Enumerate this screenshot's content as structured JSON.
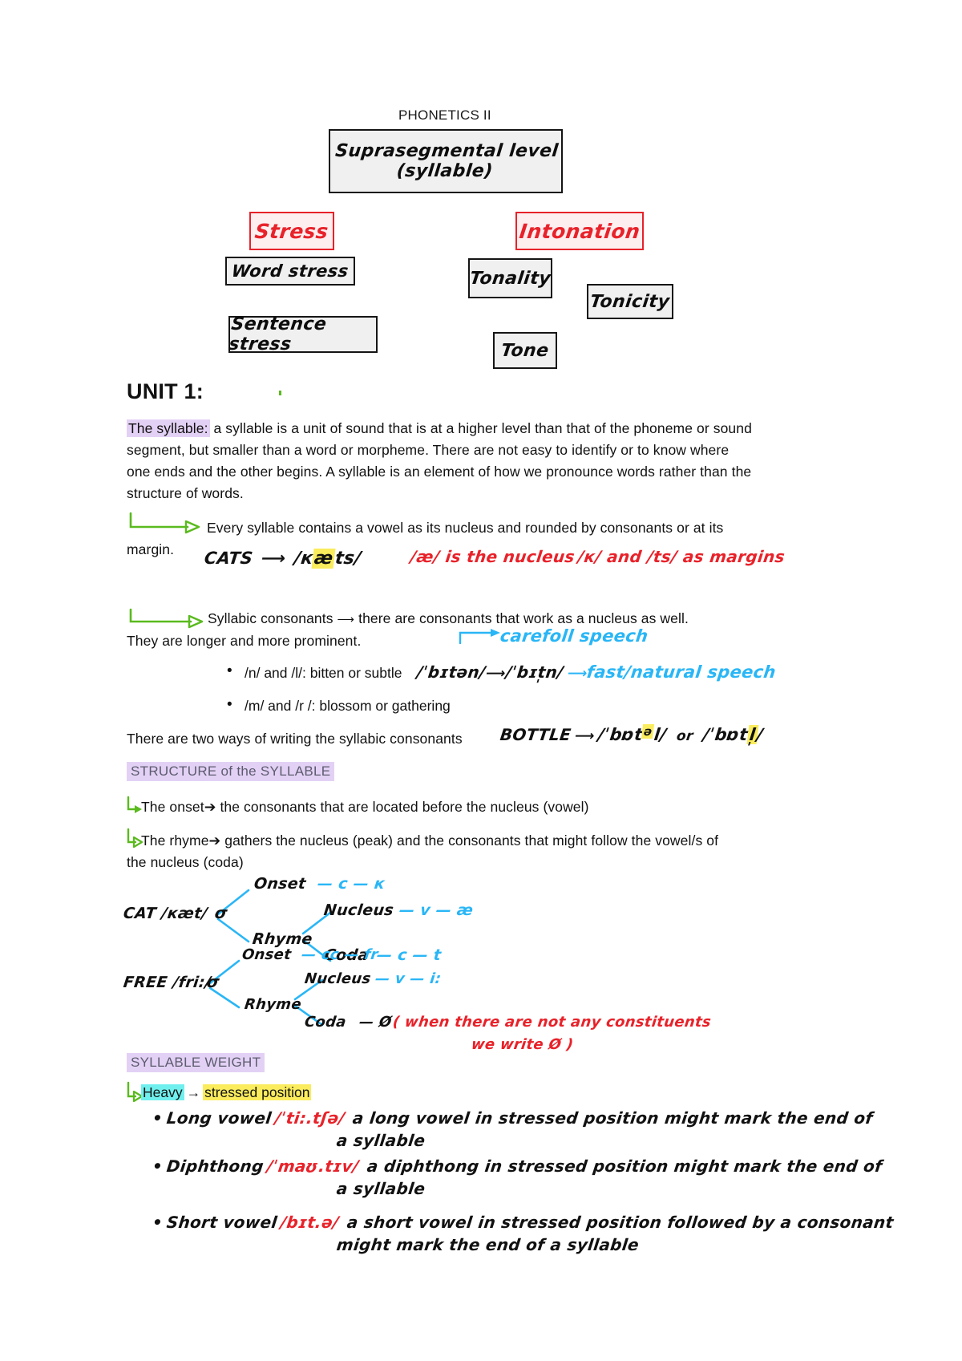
{
  "document": {
    "title": "PHONETICS II",
    "unit_heading": "UNIT 1:"
  },
  "diagram": {
    "nodes": [
      {
        "id": "supra",
        "label_line1": "Suprasegmental  level",
        "label_line2": "(syllable)",
        "style": "black"
      },
      {
        "id": "stress",
        "label": "Stress",
        "style": "red"
      },
      {
        "id": "word",
        "label": "Word stress",
        "style": "black"
      },
      {
        "id": "sentence",
        "label": "Sentence stress",
        "style": "black"
      },
      {
        "id": "intonation",
        "label": "Intonation",
        "style": "red"
      },
      {
        "id": "tonality",
        "label": "Tonality",
        "style": "black"
      },
      {
        "id": "tonicity",
        "label": "Tonicity",
        "style": "black"
      },
      {
        "id": "tone",
        "label": "Tone",
        "style": "black"
      }
    ]
  },
  "sections": {
    "syllable_def": {
      "label": "The syllable:",
      "text": " a syllable is a unit of sound that is at a higher level than that of the phoneme or sound segment, but smaller than a word or morpheme. There are not easy to identify or to know where one ends and the other begins. A syllable is an element of how we pronounce words rather than the structure of words."
    },
    "point_nucleus": {
      "text_before_margin": "Every syllable contains a vowel as its nucleus and rounded by consonants or at its",
      "text_margin": "margin.",
      "example_word": "CATS",
      "example_arrow": "⟶",
      "example_ipa_open": "/к",
      "example_ipa_highlight": "æ",
      "example_ipa_close": "ts/",
      "note_line1": "/æ/ is the nucleus",
      "note_line2": "/к/ and /ts/ as margins"
    },
    "point_syllabic": {
      "lead": "Syllabic consonants",
      "arrow": "⟶",
      "rest": "there are consonants that work as a nucleus as well.",
      "line2": "They are longer and more prominent.",
      "blue_note_careful": "carefoll  speech",
      "bullets": [
        {
          "text": "/n/ and /l/: bitten or subtle",
          "ipa_a": "/ˈbɪtən/",
          "ipa_arrow": "⟶",
          "ipa_b": "/ˈbɪt̩n/",
          "blue_arrow": "⟶",
          "blue_note": "fast/natural  speech"
        },
        {
          "text": "/m/ and /r /: blossom or gathering"
        }
      ]
    },
    "two_ways": {
      "text": "There are two ways of writing the syllabic consonants",
      "word": "BOTTLE",
      "arrow": "⟶",
      "ipa_a_pre": "/ˈbɒt",
      "ipa_a_hl": "ə",
      "ipa_a_post": "l/",
      "or": "or",
      "ipa_b_pre": "/ˈbɒt",
      "ipa_b_hl_below": "l̩",
      "ipa_b_post": "/"
    },
    "structure": {
      "heading": "STRUCTURE of the SYLLABLE",
      "onset_line": "The onset➔ the consonants that are located before the nucleus (vowel)",
      "rhyme_line": "The rhyme➔ gathers the nucleus (peak) and the consonants that might follow the vowel/s of",
      "rhyme_line2": "the nucleus (coda)"
    },
    "trees": [
      {
        "word": "CAT /кæt/",
        "sigma": "σ",
        "onset": "Onset",
        "onset_val": "— c — к",
        "rhyme": "Rhyme",
        "nucleus": "Nucleus",
        "nucleus_val": "— v — æ",
        "coda": "Coda",
        "coda_val": "— c — t"
      },
      {
        "word": "FREE /fri:/",
        "sigma": "σ",
        "onset": "Onset",
        "onset_val": "— cc — fr",
        "rhyme": "Rhyme",
        "nucleus": "Nucleus",
        "nucleus_val": "— v — i:",
        "coda": "Coda",
        "coda_val": "— Ø",
        "note_line1": "( when there are not any constituents",
        "note_line2": "we write Ø )"
      }
    ],
    "weight": {
      "heading": "SYLLABLE WEIGHT",
      "heavy_label": "Heavy",
      "heavy_arrow": "→",
      "heavy_value": "stressed position",
      "items": [
        {
          "term": "Long vowel",
          "ipa": "/ˈti:.tʃə/",
          "desc_line1": "a long vowel in stressed position might mark the end of",
          "desc_line2": "a syllable"
        },
        {
          "term": "Diphthong",
          "ipa": "/ˈmaʊ.tɪv/",
          "desc_line1": "a diphthong in stressed position might mark the end of",
          "desc_line2": "a syllable"
        },
        {
          "term": "Short vowel",
          "ipa": "/bɪt.ə/",
          "desc_line1": "a short vowel in stressed position followed by a consonant",
          "desc_line2": "might mark the end of a syllable"
        }
      ]
    }
  },
  "colors": {
    "red_ink": "#e8222a",
    "blue_ink": "#29b6f6",
    "green_arrow": "#5aba1e",
    "purple_highlight": "#e3d1f5",
    "yellow_highlight": "#faec5c",
    "cyan_highlight": "#6ff0ee"
  }
}
